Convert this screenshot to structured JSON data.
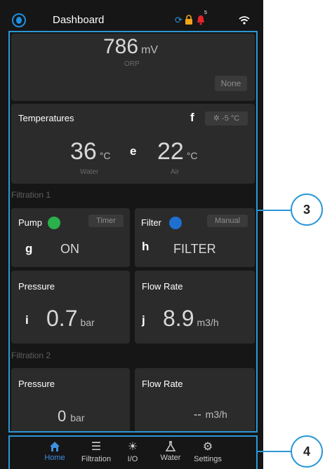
{
  "header": {
    "title": "Dashboard",
    "notification_count": "5"
  },
  "orp": {
    "value": "786",
    "unit": "mV",
    "label": "ORP",
    "mode": "None"
  },
  "temperatures": {
    "title": "Temperatures",
    "marker": "f",
    "frost": "-5 °C",
    "water_value": "36",
    "water_unit": "°C",
    "water_label": "Water",
    "marker_mid": "e",
    "air_value": "22",
    "air_unit": "°C",
    "air_label": "Air"
  },
  "filtration1": {
    "section": "Filtration 1",
    "pump": {
      "label": "Pump",
      "mode": "Timer",
      "marker": "g",
      "state": "ON",
      "dot_color": "#2bb14b"
    },
    "filter": {
      "label": "Filter",
      "mode": "Manual",
      "marker": "h",
      "state": "FILTER",
      "dot_color": "#1f6fd1"
    },
    "pressure": {
      "label": "Pressure",
      "marker": "i",
      "value": "0.7",
      "unit": "bar"
    },
    "flow": {
      "label": "Flow Rate",
      "marker": "j",
      "value": "8.9",
      "unit": "m3/h"
    }
  },
  "filtration2": {
    "section": "Filtration 2",
    "pressure": {
      "label": "Pressure",
      "value": "0",
      "unit": "bar"
    },
    "flow": {
      "label": "Flow Rate",
      "value": "--",
      "unit": "m3/h"
    }
  },
  "nav": [
    {
      "label": "Home",
      "icon": "home-icon"
    },
    {
      "label": "Filtration",
      "icon": "filtration-icon"
    },
    {
      "label": "I/O",
      "icon": "bulb-icon"
    },
    {
      "label": "Water",
      "icon": "flask-icon"
    },
    {
      "label": "Settings",
      "icon": "gear-icon"
    }
  ],
  "callouts": {
    "c3": "3",
    "c4": "4"
  },
  "colors": {
    "accent": "#2a97d6",
    "active_nav": "#3f8fe0",
    "card": "#2b2b2b",
    "background": "#161616"
  }
}
